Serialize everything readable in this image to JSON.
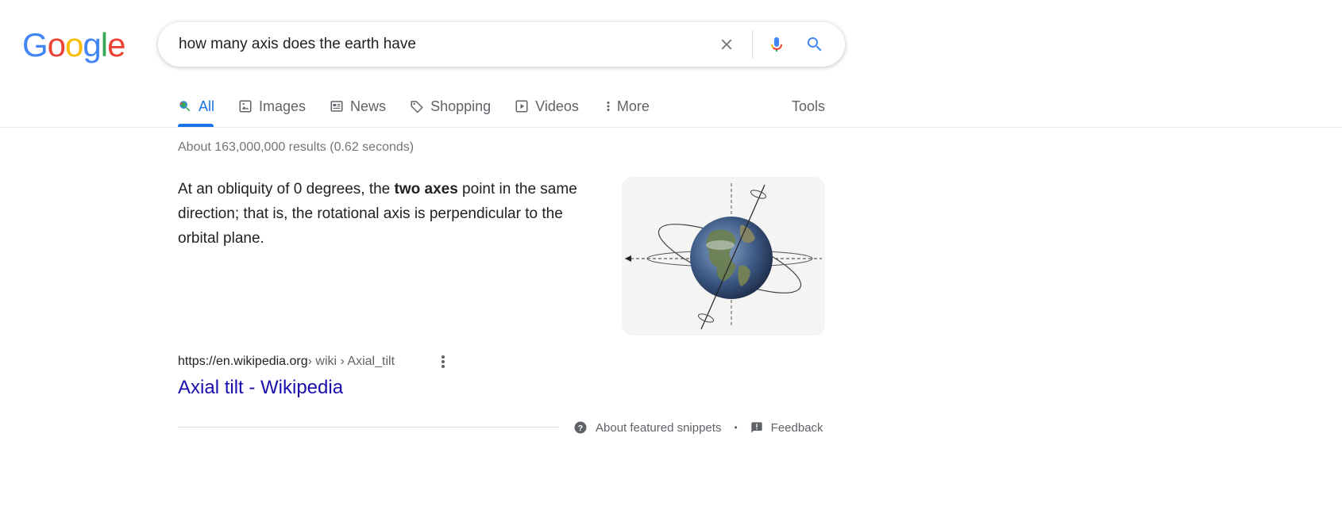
{
  "logo": {
    "letters": [
      "G",
      "o",
      "o",
      "g",
      "l",
      "e"
    ]
  },
  "search": {
    "query": "how many axis does the earth have",
    "icons": [
      "clear-icon",
      "microphone-icon",
      "search-icon"
    ]
  },
  "tabs": [
    {
      "label": "All",
      "icon": "search-icon",
      "active": true
    },
    {
      "label": "Images",
      "icon": "image-icon"
    },
    {
      "label": "News",
      "icon": "news-icon"
    },
    {
      "label": "Shopping",
      "icon": "tag-icon"
    },
    {
      "label": "Videos",
      "icon": "play-icon"
    },
    {
      "label": "More",
      "icon": "more-vert-icon"
    }
  ],
  "tools_label": "Tools",
  "result_stats": "About 163,000,000 results (0.62 seconds)",
  "snippet": {
    "text_before": "At an obliquity of 0 degrees, the ",
    "text_bold": "two axes",
    "text_after": " point in the same direction; that is, the rotational axis is perpendicular to the orbital plane.",
    "image_subject": "earth-axial-tilt-diagram"
  },
  "result": {
    "cite_domain": "https://en.wikipedia.org",
    "cite_path": " › wiki › Axial_tilt",
    "title": "Axial tilt - Wikipedia"
  },
  "footer": {
    "about_label": "About featured snippets",
    "separator": "•",
    "feedback_label": "Feedback"
  },
  "colors": {
    "accent": "#1a73e8",
    "link": "#1a0dab",
    "muted": "#70757a"
  }
}
